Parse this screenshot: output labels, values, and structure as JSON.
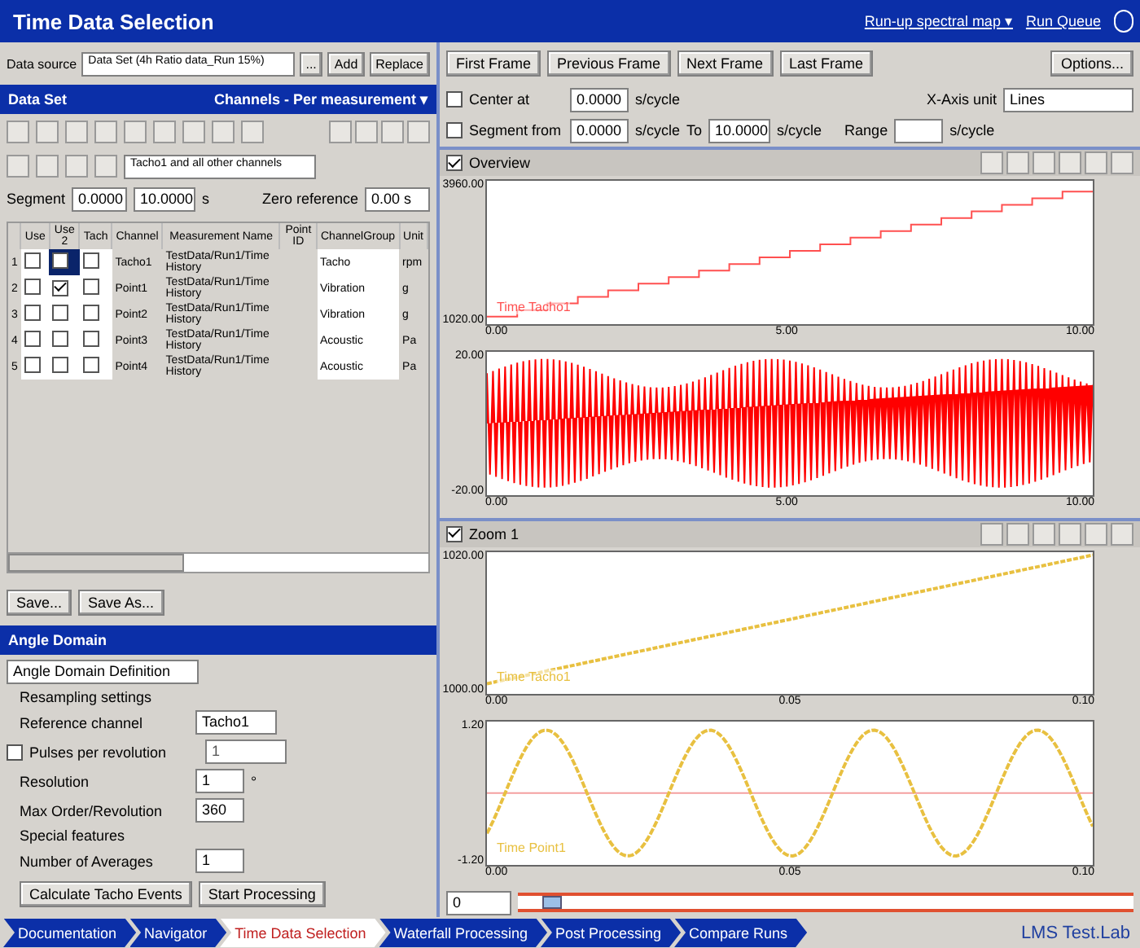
{
  "window": {
    "title": "Time Data Selection",
    "links": [
      "Run-up spectral map ▾",
      "Run Queue"
    ]
  },
  "data_source": {
    "label": "Data source",
    "value": "Data Set (4h Ratio data_Run 15%)",
    "buttons": [
      "...",
      "Add",
      "Replace"
    ]
  },
  "data_set": {
    "title": "Data Set",
    "menu": "Channels - Per measurement ▾"
  },
  "channel_filter": {
    "value": "Tacho1 and all other channels"
  },
  "segment": {
    "label": "Segment",
    "from": "0.0000",
    "to": "10.0000",
    "unit": "s"
  },
  "zero_reference": {
    "label": "Zero reference",
    "value": "0.00 s"
  },
  "table": {
    "columns": [
      "Use",
      "Use 2",
      "Tach",
      "Channel",
      "Measurement Name",
      "Point ID",
      "ChannelGroup",
      "Unit"
    ],
    "rows": [
      {
        "number": "1",
        "use": false,
        "use2": false,
        "tach": false,
        "selected": true,
        "channel": "Tacho1",
        "measurement": "TestData/Run1/Time History",
        "group": "Tacho",
        "unit": "rpm"
      },
      {
        "number": "2",
        "use": false,
        "use2": true,
        "tach": false,
        "selected": false,
        "channel": "Point1",
        "measurement": "TestData/Run1/Time History",
        "group": "Vibration",
        "unit": "g"
      },
      {
        "number": "3",
        "use": false,
        "use2": false,
        "tach": false,
        "selected": false,
        "channel": "Point2",
        "measurement": "TestData/Run1/Time History",
        "group": "Vibration",
        "unit": "g"
      },
      {
        "number": "4",
        "use": false,
        "use2": false,
        "tach": false,
        "selected": false,
        "channel": "Point3",
        "measurement": "TestData/Run1/Time History",
        "group": "Acoustic",
        "unit": "Pa"
      },
      {
        "number": "5",
        "use": false,
        "use2": false,
        "tach": false,
        "selected": false,
        "channel": "Point4",
        "measurement": "TestData/Run1/Time History",
        "group": "Acoustic",
        "unit": "Pa"
      }
    ]
  },
  "table_buttons": [
    "Save...",
    "Save As..."
  ],
  "angle_panel": {
    "title": "Angle Domain",
    "mode": "Angle Domain Definition",
    "section": "Resampling settings",
    "fields": [
      {
        "kind": "select",
        "label": "Reference channel",
        "value": "Tacho1"
      },
      {
        "kind": "check",
        "label": "Pulses per revolution",
        "value": "1",
        "checked": false
      },
      {
        "kind": "input",
        "label": "Resolution",
        "value": "1",
        "unit": "°"
      },
      {
        "kind": "input",
        "label": "Max Order/Revolution",
        "value": "360"
      },
      {
        "kind": "heading",
        "label": "Special features"
      },
      {
        "kind": "input",
        "label": "Number of Averages",
        "value": "1"
      }
    ],
    "buttons": [
      "Calculate Tacho Events",
      "Start Processing"
    ]
  },
  "frame_buttons": [
    "First Frame",
    "Previous Frame",
    "Next Frame",
    "Last Frame"
  ],
  "options_button": "Options...",
  "center_at": {
    "label": "Center at",
    "value": "0.0000",
    "unit": "s/cycle",
    "checked": false
  },
  "segment_from": {
    "label": "Segment from",
    "value": "0.0000",
    "unit": "s/cycle",
    "to_label": "To",
    "to_value": "10.0000",
    "to_unit": "s/cycle",
    "range_label": "Range",
    "range_unit": "s/cycle",
    "checked": false
  },
  "x_axis": {
    "label": "X-Axis unit",
    "value": "Lines"
  },
  "overview": {
    "title": "Overview",
    "checked": true,
    "charts": [
      {
        "kind": "steps",
        "color": "#ff5050",
        "trace_label": "Time Tacho1",
        "y_ticks": [
          "3960.00",
          "1020.00"
        ],
        "x_ticks": [
          "0.00",
          "5.00",
          "10.00"
        ]
      },
      {
        "kind": "band",
        "color": "#ff0000",
        "y_ticks": [
          "20.00",
          "-20.00"
        ],
        "x_ticks": [
          "0.00",
          "5.00",
          "10.00"
        ]
      }
    ]
  },
  "zoom": {
    "title": "Zoom 1",
    "checked": true,
    "charts": [
      {
        "kind": "dots",
        "color": "#e8c040",
        "trace_label": "Time Tacho1",
        "y_ticks": [
          "1020.00",
          "1000.00"
        ],
        "x_ticks": [
          "0.00",
          "0.05",
          "0.10"
        ]
      },
      {
        "kind": "sine",
        "color": "#e8c040",
        "trace_label": "Time Point1",
        "y_ticks": [
          "1.20",
          "-1.20"
        ],
        "x_ticks": [
          "0.00",
          "0.05",
          "0.10"
        ]
      }
    ]
  },
  "position": {
    "value": "0",
    "level": 0.04
  },
  "workflow": [
    {
      "label": "Documentation",
      "selected": false
    },
    {
      "label": "Navigator",
      "selected": false
    },
    {
      "label": "Time Data Selection",
      "selected": true
    },
    {
      "label": "Waterfall Processing",
      "selected": false
    },
    {
      "label": "Post Processing",
      "selected": false
    },
    {
      "label": "Compare Runs",
      "selected": false
    }
  ],
  "brand": "LMS Test.Lab"
}
